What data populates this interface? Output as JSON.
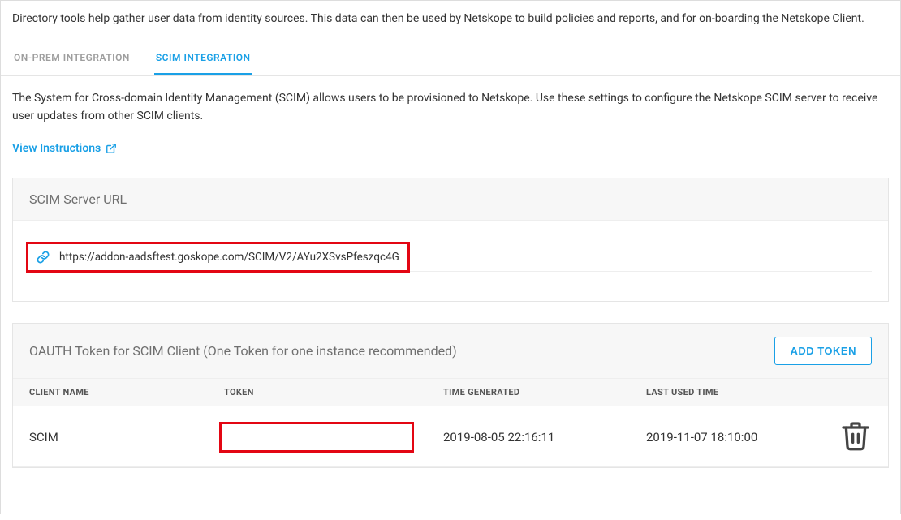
{
  "intro": "Directory tools help gather user data from identity sources. This data can then be used by Netskope to build policies and reports, and for on-boarding the Netskope Client.",
  "tabs": {
    "onprem": "ON-PREM INTEGRATION",
    "scim": "SCIM INTEGRATION"
  },
  "scim": {
    "description": "The System for Cross-domain Identity Management (SCIM) allows users to be provisioned to Netskope. Use these settings to configure the Netskope SCIM server to receive user updates from other SCIM clients.",
    "view_instructions": "View Instructions",
    "server_url_title": "SCIM Server URL",
    "server_url": "https://addon-aadsftest.goskope.com/SCIM/V2/AYu2XSvsPfeszqc4G",
    "oauth_title": "OAUTH Token for SCIM Client (One Token for one instance recommended)",
    "add_token_label": "ADD TOKEN",
    "columns": {
      "client": "CLIENT NAME",
      "token": "TOKEN",
      "time_generated": "TIME GENERATED",
      "last_used": "LAST USED TIME"
    },
    "rows": [
      {
        "client": "SCIM",
        "token": "",
        "time_generated": "2019-08-05 22:16:11",
        "last_used": "2019-11-07 18:10:00"
      }
    ]
  }
}
